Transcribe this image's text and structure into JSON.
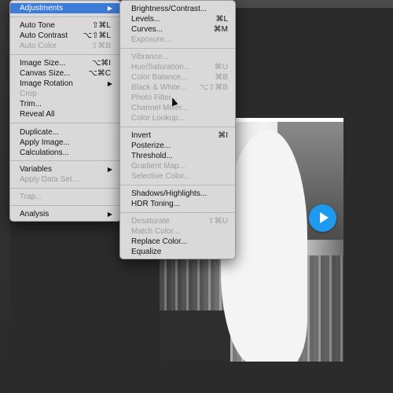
{
  "main_menu": {
    "items": [
      {
        "label": "Adjustments",
        "shortcut": "",
        "submenu": true,
        "disabled": false,
        "highlight": true
      },
      {
        "label": "Auto Tone",
        "shortcut": "⇧⌘L",
        "disabled": false
      },
      {
        "label": "Auto Contrast",
        "shortcut": "⌥⇧⌘L",
        "disabled": false
      },
      {
        "label": "Auto Color",
        "shortcut": "⇧⌘B",
        "disabled": true
      },
      {
        "label": "Image Size...",
        "shortcut": "⌥⌘I",
        "disabled": false
      },
      {
        "label": "Canvas Size...",
        "shortcut": "⌥⌘C",
        "disabled": false
      },
      {
        "label": "Image Rotation",
        "shortcut": "",
        "submenu": true,
        "disabled": false
      },
      {
        "label": "Crop",
        "shortcut": "",
        "disabled": true
      },
      {
        "label": "Trim...",
        "shortcut": "",
        "disabled": false
      },
      {
        "label": "Reveal All",
        "shortcut": "",
        "disabled": false
      },
      {
        "label": "Duplicate...",
        "shortcut": "",
        "disabled": false
      },
      {
        "label": "Apply Image...",
        "shortcut": "",
        "disabled": false
      },
      {
        "label": "Calculations...",
        "shortcut": "",
        "disabled": false
      },
      {
        "label": "Variables",
        "shortcut": "",
        "submenu": true,
        "disabled": false
      },
      {
        "label": "Apply Data Set...",
        "shortcut": "",
        "disabled": true
      },
      {
        "label": "Trap...",
        "shortcut": "",
        "disabled": true
      },
      {
        "label": "Analysis",
        "shortcut": "",
        "submenu": true,
        "disabled": false
      }
    ]
  },
  "adjustments_menu": {
    "items": [
      {
        "label": "Brightness/Contrast...",
        "shortcut": "",
        "disabled": false
      },
      {
        "label": "Levels...",
        "shortcut": "⌘L",
        "disabled": false
      },
      {
        "label": "Curves...",
        "shortcut": "⌘M",
        "disabled": false
      },
      {
        "label": "Exposure...",
        "shortcut": "",
        "disabled": true
      },
      {
        "label": "Vibrance...",
        "shortcut": "",
        "disabled": true
      },
      {
        "label": "Hue/Saturation...",
        "shortcut": "⌘U",
        "disabled": true
      },
      {
        "label": "Color Balance...",
        "shortcut": "⌘B",
        "disabled": true
      },
      {
        "label": "Black & White...",
        "shortcut": "⌥⇧⌘B",
        "disabled": true
      },
      {
        "label": "Photo Filter...",
        "shortcut": "",
        "disabled": true
      },
      {
        "label": "Channel Mixer...",
        "shortcut": "",
        "disabled": true
      },
      {
        "label": "Color Lookup...",
        "shortcut": "",
        "disabled": true
      },
      {
        "label": "Invert",
        "shortcut": "⌘I",
        "disabled": false
      },
      {
        "label": "Posterize...",
        "shortcut": "",
        "disabled": false
      },
      {
        "label": "Threshold...",
        "shortcut": "",
        "disabled": false
      },
      {
        "label": "Gradient Map...",
        "shortcut": "",
        "disabled": true
      },
      {
        "label": "Selective Color...",
        "shortcut": "",
        "disabled": true
      },
      {
        "label": "Shadows/Highlights...",
        "shortcut": "",
        "disabled": false
      },
      {
        "label": "HDR Toning...",
        "shortcut": "",
        "disabled": false
      },
      {
        "label": "Desaturate",
        "shortcut": "⇧⌘U",
        "disabled": true
      },
      {
        "label": "Match Color...",
        "shortcut": "",
        "disabled": true
      },
      {
        "label": "Replace Color...",
        "shortcut": "",
        "disabled": false
      },
      {
        "label": "Equalize",
        "shortcut": "",
        "disabled": false
      }
    ]
  },
  "submenu_arrow": "▶",
  "colors": {
    "menu_bg": "#d9d9d9",
    "highlight": "#3d7bd9",
    "play_button": "#1e9bf0"
  },
  "icons": {
    "play": "play-icon"
  }
}
